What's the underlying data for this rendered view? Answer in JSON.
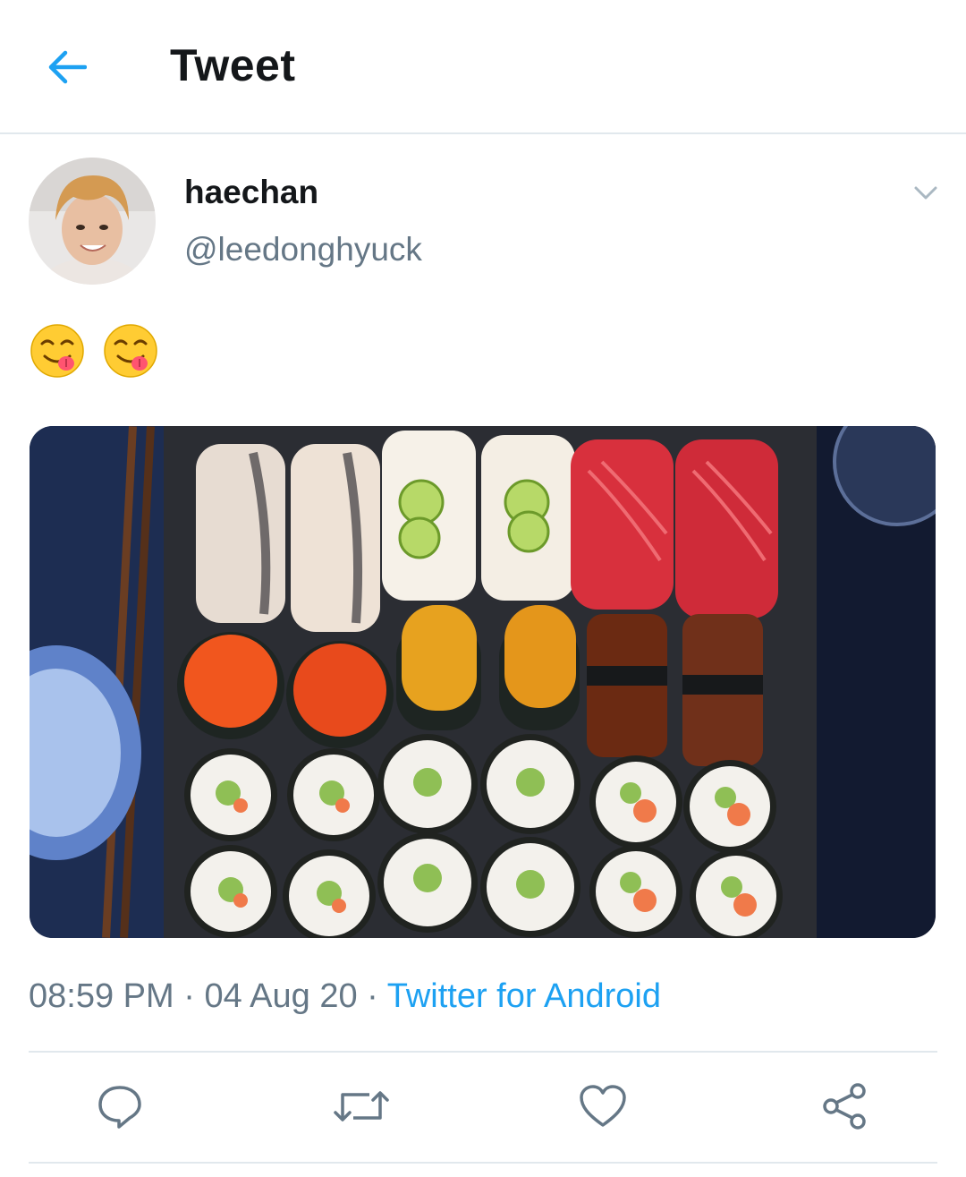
{
  "header": {
    "title": "Tweet",
    "back_icon": "arrow-left-icon",
    "accent_color": "#1da1f2"
  },
  "tweet": {
    "author": {
      "name": "haechan",
      "handle": "@leedonghyuck"
    },
    "text": "😋😋",
    "media_description": "sushi platter",
    "time": "08:59 PM",
    "date": "04 Aug 20",
    "source": "Twitter for Android",
    "separator": "·"
  },
  "actions": [
    {
      "name": "reply",
      "icon": "reply-icon"
    },
    {
      "name": "retweet",
      "icon": "retweet-icon"
    },
    {
      "name": "like",
      "icon": "heart-icon"
    },
    {
      "name": "share",
      "icon": "share-icon"
    }
  ],
  "colors": {
    "text": "#14171a",
    "secondary": "#657786",
    "link": "#1da1f2",
    "border": "#e1e8ed"
  }
}
